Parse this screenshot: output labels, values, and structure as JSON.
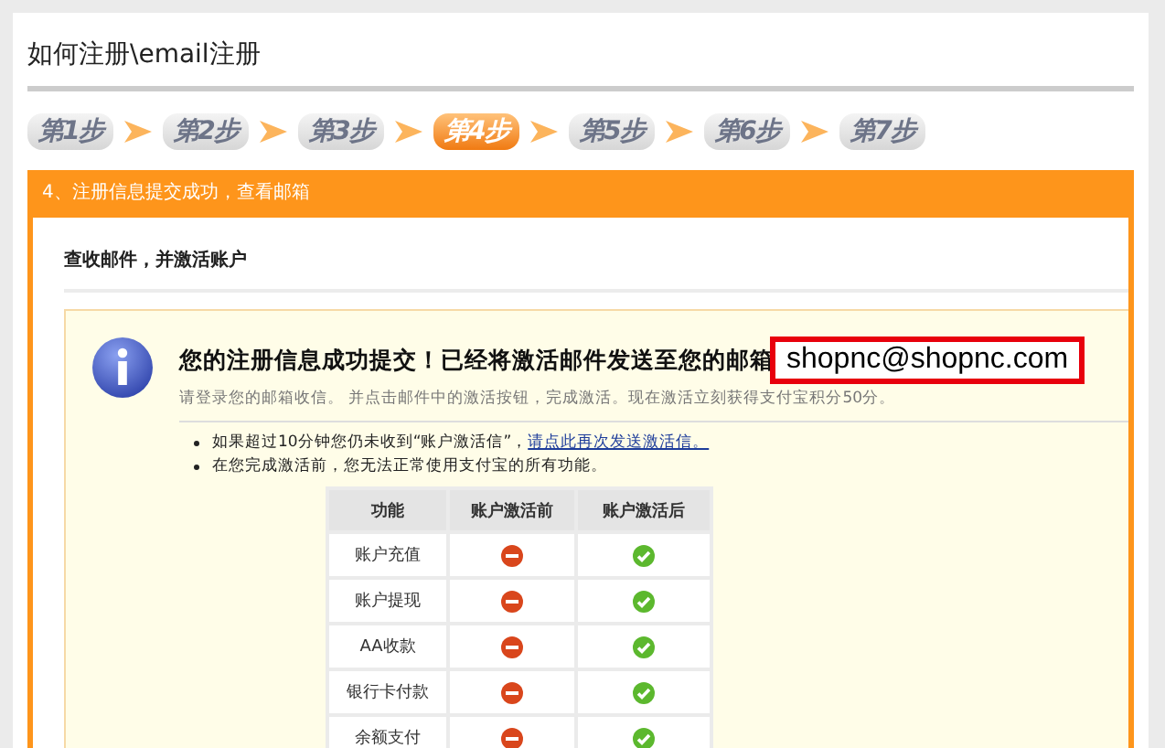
{
  "page_title": "如何注册\\email注册",
  "steps": [
    {
      "label": "第1步",
      "selected": false
    },
    {
      "label": "第2步",
      "selected": false
    },
    {
      "label": "第3步",
      "selected": false
    },
    {
      "label": "第4步",
      "selected": true
    },
    {
      "label": "第5步",
      "selected": false
    },
    {
      "label": "第6步",
      "selected": false
    },
    {
      "label": "第7步",
      "selected": false
    }
  ],
  "panel": {
    "header": "4、注册信息提交成功，查看邮箱",
    "section_title": "查收邮件，并激活账户",
    "notice": {
      "heading": "您的注册信息成功提交！已经将激活邮件发送至您的邮箱",
      "email": "shopnc@shopnc.com",
      "subtext": "请登录您的邮箱收信。 并点击邮件中的激活按钮，完成激活。现在激活立刻获得支付宝积分50分。",
      "bullets": [
        {
          "text": "如果超过10分钟您仍未收到“账户激活信”，",
          "link": "请点此再次发送激活信。"
        },
        {
          "text": "在您完成激活前，您无法正常使用支付宝的所有功能。"
        }
      ]
    },
    "table": {
      "columns": [
        "功能",
        "账户激活前",
        "账户激活后"
      ],
      "rows": [
        {
          "feature": "账户充值",
          "before_available": false,
          "after_available": true
        },
        {
          "feature": "账户提现",
          "before_available": false,
          "after_available": true
        },
        {
          "feature": "AA收款",
          "before_available": false,
          "after_available": true
        },
        {
          "feature": "银行卡付款",
          "before_available": false,
          "after_available": true
        },
        {
          "feature": "余额支付",
          "before_available": false,
          "after_available": true
        }
      ]
    }
  }
}
